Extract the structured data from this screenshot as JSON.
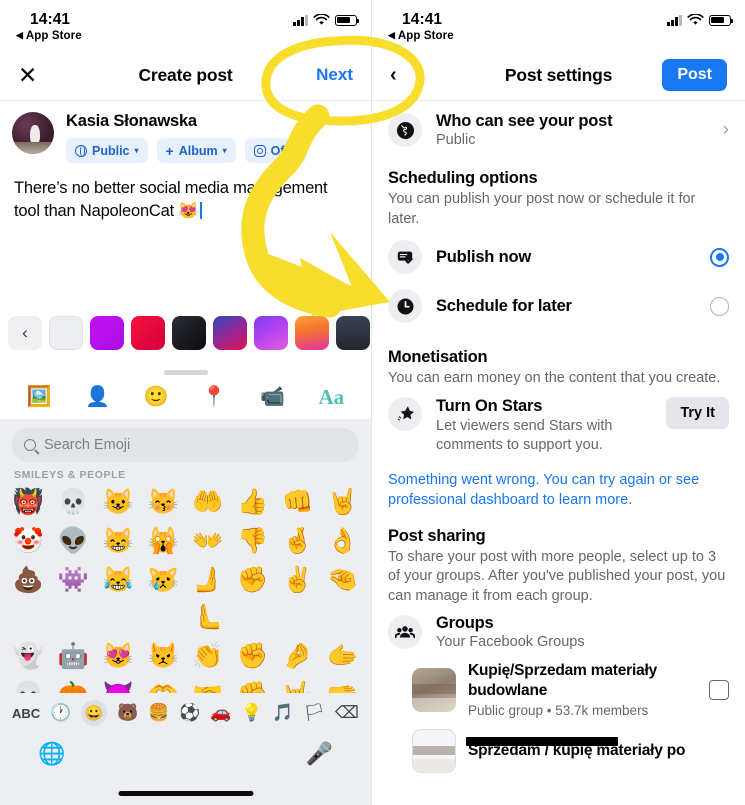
{
  "status_bar": {
    "time": "14:41",
    "back_label": "App Store",
    "back_arrow": "◀",
    "icons": [
      "signal-bars-icon",
      "wifi-icon",
      "battery-icon"
    ]
  },
  "left_panel": {
    "navbar": {
      "close_icon": "✕",
      "title": "Create post",
      "next_label": "Next"
    },
    "composer": {
      "user_name": "Kasia Słonawska",
      "avatar": "user-avatar",
      "pills": [
        {
          "icon": "globe-icon",
          "label": "Public",
          "caret": "▾"
        },
        {
          "icon": "plus-icon",
          "label": "Album",
          "caret": "▾"
        },
        {
          "icon": "instagram-icon",
          "label": "Off",
          "caret": "▾"
        }
      ],
      "text": "There’s no better social media management tool than NapoleonCat 😻"
    },
    "background_swatches": {
      "back_arrow": "‹",
      "colors": [
        "#eceef1",
        "#c312f5",
        "#e8113f",
        "#17181c",
        "#d3145a",
        "#b744ef",
        "#f5762a",
        "#3b4252"
      ],
      "gradients": [
        "linear-gradient(135deg,#c312f5,#a80de0)",
        "linear-gradient(135deg,#f5123f,#d2003a)",
        "linear-gradient(135deg,#2a2d34,#0b0c0f)",
        "linear-gradient(150deg,#2f4ab5 0%,#8a2a9e 45%,#e0114f 100%)",
        "linear-gradient(150deg,#7b3bf0 0%,#b744ef 50%,#e05fd8 100%)",
        "linear-gradient(170deg,#f7a13a 0%,#f5762a 40%,#e0349c 100%)",
        "linear-gradient(180deg,#3b4252,#23262f)"
      ],
      "grid_button": "more-backgrounds-icon"
    },
    "keyboard": {
      "toolbar_icons": [
        "photo-icon",
        "tag-people-icon",
        "feeling-icon",
        "location-icon",
        "live-video-icon",
        "text-style-icon"
      ],
      "text_style_label": "Aa",
      "search_placeholder": "Search Emoji",
      "search_icon": "search-icon",
      "category_label": "SMILEYS & PEOPLE",
      "emoji_rows": [
        [
          "👹",
          "💀",
          "😺",
          "😽",
          "🤲",
          "👍",
          "👊",
          "🤘"
        ],
        [
          "🤡",
          "👽",
          "😸",
          "🙀",
          "👐",
          "👎",
          "🤞",
          "👌"
        ],
        [
          "💩",
          "👾",
          "😹",
          "😿",
          "🫸🫷",
          "✊",
          "✌️",
          "🤏"
        ],
        [
          "👻",
          "🤖",
          "😻",
          "😾",
          "👏",
          "✊",
          "🤌",
          "🫱"
        ],
        [
          "💀",
          "🎃",
          "😈",
          "🫶",
          "🤝",
          "✊",
          "🤟",
          "🫳"
        ]
      ],
      "bottom_bar": {
        "abc_label": "ABC",
        "category_icons": [
          "recent-icon",
          "smileys-icon",
          "animals-icon",
          "food-icon",
          "activity-icon",
          "travel-icon",
          "objects-icon",
          "symbols-icon",
          "flags-icon"
        ],
        "delete_icon": "backspace-icon"
      },
      "footer": {
        "globe_icon": "language-globe-icon",
        "mic_icon": "dictation-mic-icon"
      }
    }
  },
  "right_panel": {
    "navbar": {
      "back_icon": "‹",
      "title": "Post settings",
      "post_label": "Post"
    },
    "audience": {
      "icon": "globe-icon",
      "title": "Who can see your post",
      "subtitle": "Public",
      "chevron": "›"
    },
    "scheduling": {
      "title": "Scheduling options",
      "description": "You can publish your post now or schedule it for later.",
      "options": [
        {
          "icon": "publish-now-icon",
          "label": "Publish now",
          "selected": true
        },
        {
          "icon": "clock-icon",
          "label": "Schedule for later",
          "selected": false
        }
      ]
    },
    "monetisation": {
      "title": "Monetisation",
      "description": "You can earn money on the content that you create.",
      "item": {
        "icon": "star-icon",
        "title": "Turn On Stars",
        "subtitle": "Let viewers send Stars with comments to support you.",
        "button_label": "Try It"
      },
      "error_text": "Something went wrong. You can try again or see professional dashboard to learn more."
    },
    "post_sharing": {
      "title": "Post sharing",
      "description": "To share your post with more people, select up to 3 of your groups. After you've published your post, you can manage it from each group.",
      "groups_row": {
        "icon": "groups-icon",
        "title": "Groups",
        "subtitle": "Your Facebook Groups"
      },
      "groups": [
        {
          "thumb": "group-thumbnail",
          "name": "Kupię/Sprzedam materiały budowlane",
          "meta": "Public group • 53.7k members",
          "checked": false
        },
        {
          "thumb": "group-thumbnail",
          "name": "Sprzedam / kupię materiały po",
          "meta": "",
          "checked": false
        }
      ]
    }
  },
  "annotation": {
    "type": "highlight-circle-and-arrow",
    "color": "#f7de2d",
    "target": "Next"
  }
}
